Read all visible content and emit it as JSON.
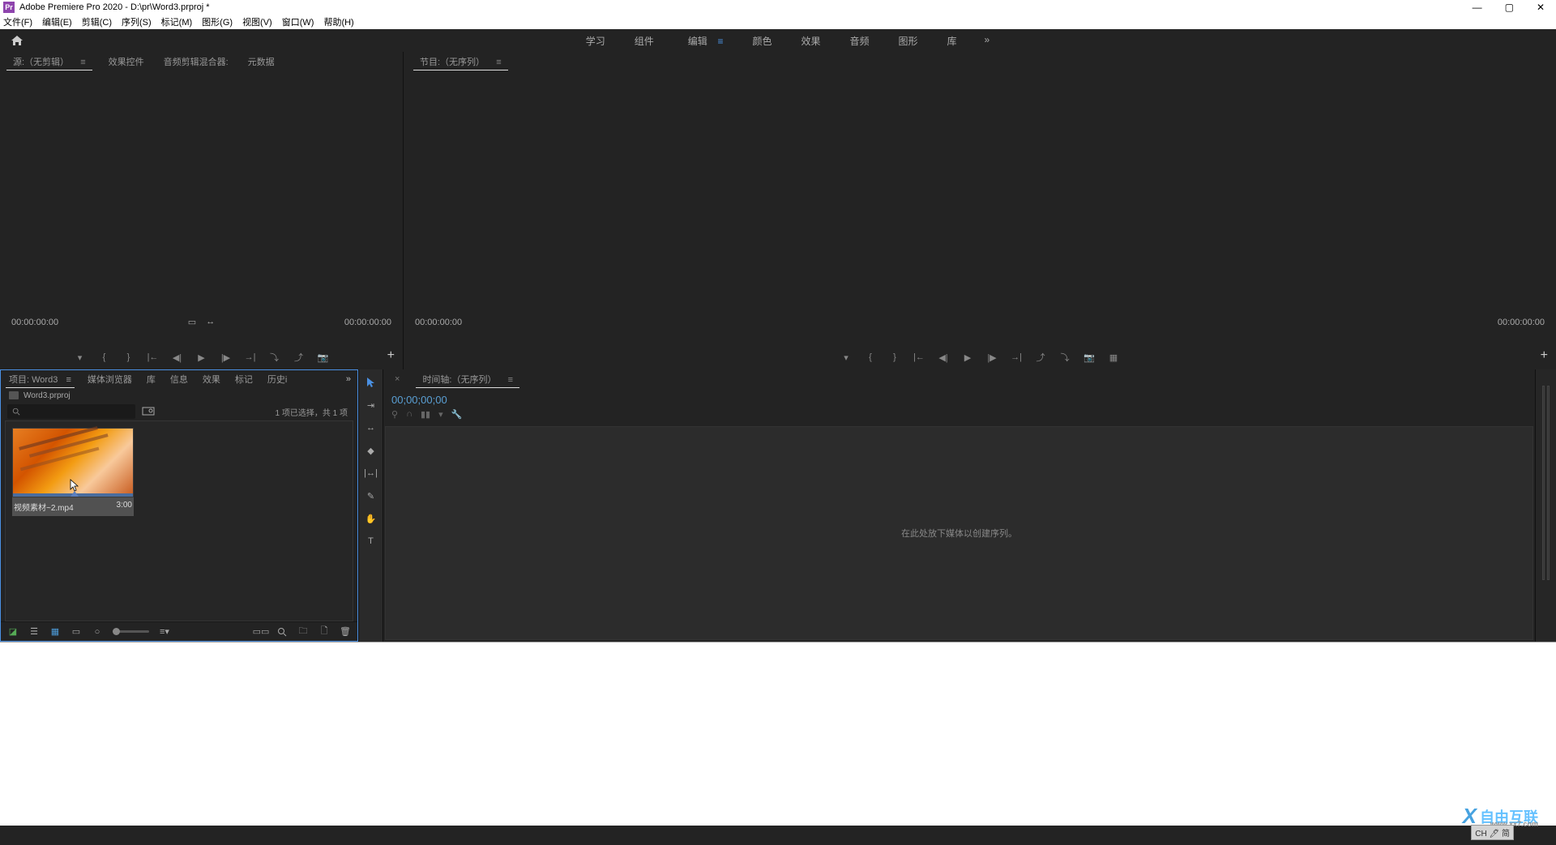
{
  "titlebar": {
    "app_name": "Adobe Premiere Pro 2020",
    "project_path": "D:\\pr\\Word3.prproj *"
  },
  "menubar": [
    "文件(F)",
    "编辑(E)",
    "剪辑(C)",
    "序列(S)",
    "标记(M)",
    "图形(G)",
    "视图(V)",
    "窗口(W)",
    "帮助(H)"
  ],
  "workspaces": {
    "items": [
      "学习",
      "组件",
      "编辑",
      "颜色",
      "效果",
      "音频",
      "图形",
      "库"
    ],
    "active": 2,
    "overflow": "»"
  },
  "source_panel": {
    "tabs": [
      "源:（无剪辑）",
      "效果控件",
      "音频剪辑混合器:",
      "元数据"
    ],
    "active": 0,
    "tc_left": "00:00:00:00",
    "tc_right": "00:00:00:00"
  },
  "program_panel": {
    "tab": "节目:（无序列）",
    "tc_left": "00:00:00:00",
    "tc_right": "00:00:00:00"
  },
  "project_panel": {
    "tabs": [
      "项目: Word3",
      "媒体浏览器",
      "库",
      "信息",
      "效果",
      "标记",
      "历史i"
    ],
    "active": 0,
    "file_name": "Word3.prproj",
    "status": "1 项已选择，共 1 项",
    "clip": {
      "name": "视频素材~2.mp4",
      "duration": "3:00"
    }
  },
  "timeline_panel": {
    "tab": "时间轴:（无序列）",
    "tc": "00;00;00;00",
    "empty_msg": "在此处放下媒体以创建序列。"
  },
  "ime": "CH 🖊 简",
  "watermark": {
    "main": "自由互联",
    "sub": "www.xx7.com"
  }
}
